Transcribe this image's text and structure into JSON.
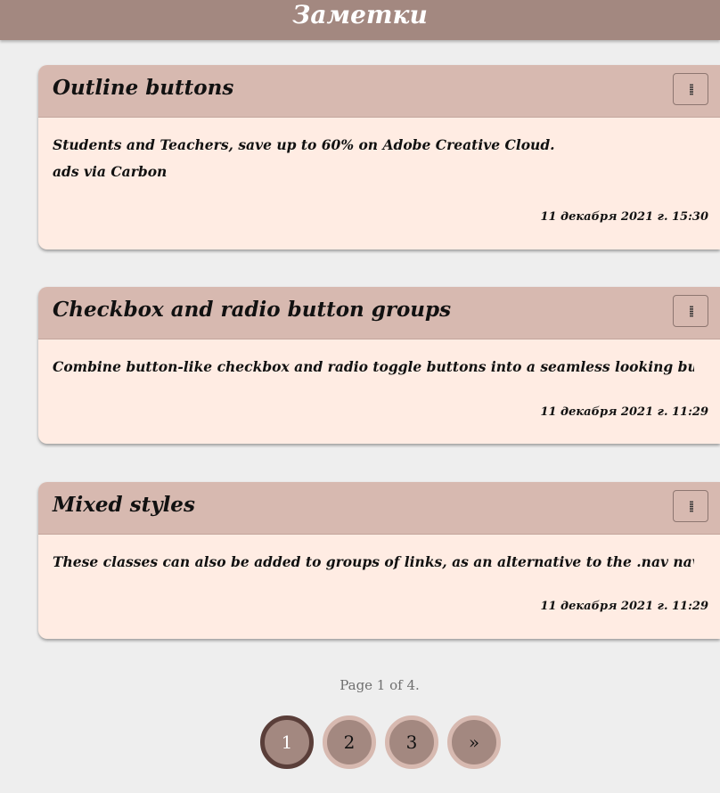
{
  "header": {
    "title": "Заметки"
  },
  "notes": [
    {
      "title": "Outline buttons",
      "lines": [
        "Students and Teachers, save up to 60% on Adobe Creative Cloud.",
        "ads via Carbon"
      ],
      "date": "11 декабря 2021 г. 15:30",
      "menu_icon": "vertical-dots-icon"
    },
    {
      "title": "Checkbox and radio button groups",
      "lines": [
        "Combine button-like checkbox and radio toggle buttons into a seamless looking button grou..."
      ],
      "date": "11 декабря 2021 г. 11:29",
      "menu_icon": "vertical-dots-icon"
    },
    {
      "title": "Mixed styles",
      "lines": [
        "These classes can also be added to groups of links, as an alternative to the .nav navigat..."
      ],
      "date": "11 декабря 2021 г. 11:29",
      "menu_icon": "vertical-dots-icon"
    }
  ],
  "pagination": {
    "info": "Page 1 of 4.",
    "current_page": 1,
    "pages": [
      "1",
      "2",
      "3"
    ],
    "next_label": "»"
  },
  "colors": {
    "header_bg": "#a38880",
    "card_header_bg": "#d7b9b0",
    "card_body_bg": "#ffece3",
    "page_bg": "#eeeeee",
    "active_page_border": "#5a3e39"
  }
}
